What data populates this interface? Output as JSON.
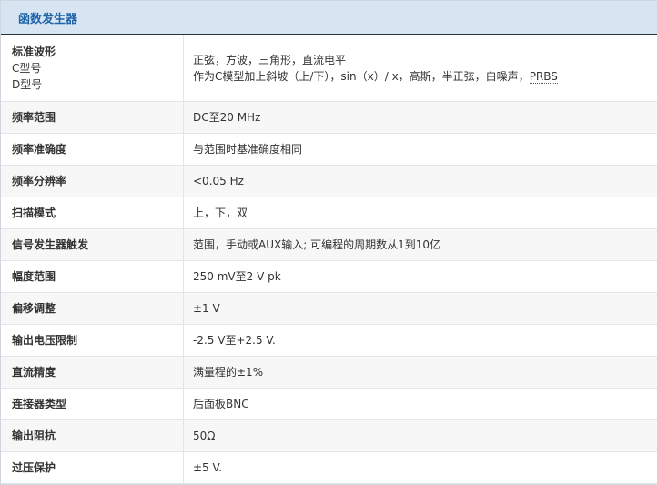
{
  "header": {
    "title": "函数发生器"
  },
  "first_row": {
    "key_title": "标准波形",
    "key_sub1": "C型号",
    "key_sub2": "D型号",
    "val_line1": "正弦，方波，三角形，直流电平",
    "val_line2_prefix": "作为C模型加上斜坡（上/下），sin（x）/ x，高斯，半正弦，白噪声，",
    "val_line2_abbr": "PRBS"
  },
  "rows": [
    {
      "key": "频率范围",
      "value": "DC至20 MHz"
    },
    {
      "key": "频率准确度",
      "value": "与范围时基准确度相同"
    },
    {
      "key": "频率分辨率",
      "value": "<0.05 Hz"
    },
    {
      "key": "扫描模式",
      "value": "上，下，双"
    },
    {
      "key": "信号发生器触发",
      "value": "范围，手动或AUX输入; 可编程的周期数从1到10亿"
    },
    {
      "key": "幅度范围",
      "value": "250 mV至2 V pk"
    },
    {
      "key": "偏移调整",
      "value": "±1 V"
    },
    {
      "key": "输出电压限制",
      "value": "-2.5 V至+2.5 V."
    },
    {
      "key": "直流精度",
      "value": "满量程的±1%"
    },
    {
      "key": "连接器类型",
      "value": "后面板BNC"
    },
    {
      "key": "输出阻抗",
      "value": "50Ω"
    },
    {
      "key": "过压保护",
      "value": "±5 V."
    }
  ]
}
